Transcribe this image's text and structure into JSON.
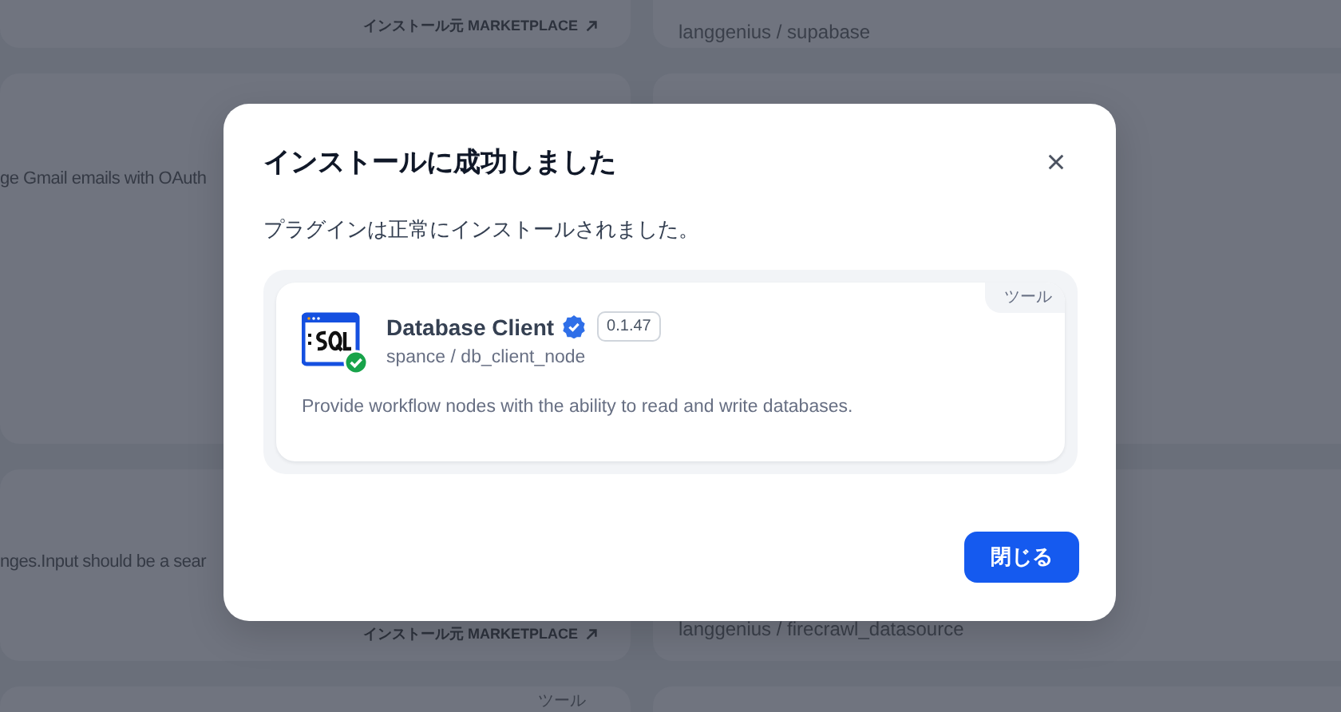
{
  "background": {
    "left_cards": [
      {
        "source": "インストール元 MARKETPLACE"
      },
      {
        "description": "ge Gmail emails with OAuth"
      },
      {
        "description": "nges.Input should be a sear",
        "source": "インストール元 MARKETPLACE"
      },
      {
        "tag": "ツール"
      }
    ],
    "right_cards": [
      {
        "author": "langgenius / supabase"
      },
      {
        "author": "langgenius / firecrawl_datasource"
      }
    ]
  },
  "dialog": {
    "title": "インストールに成功しました",
    "message": "プラグインは正常にインストールされました。",
    "plugin": {
      "name": "Database Client",
      "verified": true,
      "version": "0.1.47",
      "author": "spance / db_client_node",
      "description": "Provide workflow nodes with the ability to read and write databases.",
      "tag": "ツール",
      "installed": true
    },
    "button": "閉じる"
  }
}
